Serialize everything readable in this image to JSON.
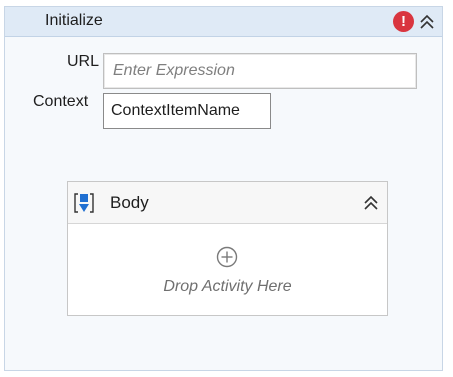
{
  "activity": {
    "title": "Initialize",
    "error_icon_glyph": "!",
    "error_color": "#d9353f",
    "header_color": "#dfeaf6"
  },
  "properties": {
    "url_label": "URL",
    "url_placeholder": "Enter Expression",
    "url_value": "",
    "context_label": "Context",
    "context_value": "ContextItemName"
  },
  "body": {
    "title": "Body",
    "icon": "sequence-icon",
    "drop_hint": "Drop Activity Here",
    "add_icon": "plus-circle-icon"
  }
}
